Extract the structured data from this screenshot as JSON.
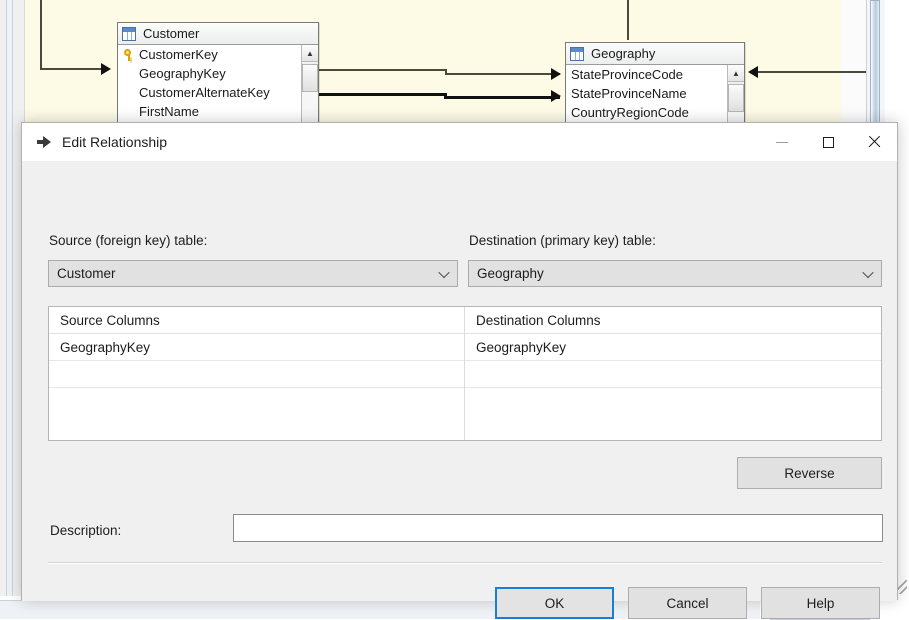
{
  "background": {
    "canvas_color": "#fdfbe6",
    "tables": [
      {
        "name": "Customer",
        "icon": "table-grid-icon",
        "columns": [
          {
            "label": "CustomerKey",
            "key": true
          },
          {
            "label": "GeographyKey",
            "key": false
          },
          {
            "label": "CustomerAlternateKey",
            "key": false
          },
          {
            "label": "FirstName",
            "key": false
          }
        ]
      },
      {
        "name": "Geography",
        "icon": "table-grid-icon",
        "columns": [
          {
            "label": "StateProvinceCode",
            "key": false
          },
          {
            "label": "StateProvinceName",
            "key": false
          },
          {
            "label": "CountryRegionCode",
            "key": false
          }
        ]
      }
    ]
  },
  "dialog": {
    "title": "Edit Relationship",
    "title_icon": "relationship-arrow-icon",
    "window_controls": {
      "minimize": "minimize-icon",
      "maximize": "maximize-icon",
      "close": "close-icon"
    },
    "source": {
      "label": "Source (foreign key) table:",
      "value": "Customer"
    },
    "destination": {
      "label": "Destination (primary key) table:",
      "value": "Geography"
    },
    "columns_grid": {
      "headers": [
        "Source Columns",
        "Destination Columns"
      ],
      "rows": [
        {
          "source": "GeographyKey",
          "destination": "GeographyKey"
        },
        {
          "source": "",
          "destination": ""
        }
      ]
    },
    "reverse_button": "Reverse",
    "description": {
      "label": "Description:",
      "value": "",
      "placeholder": ""
    },
    "footer_buttons": [
      {
        "label": "OK",
        "focused": true
      },
      {
        "label": "Cancel",
        "focused": false
      },
      {
        "label": "Help",
        "focused": false
      }
    ],
    "accent_color": "#1a7fd4"
  },
  "statusbar": {
    "icons": [
      "collapse-down-icon",
      "pin-icon",
      "chevron-double-down-icon"
    ]
  }
}
